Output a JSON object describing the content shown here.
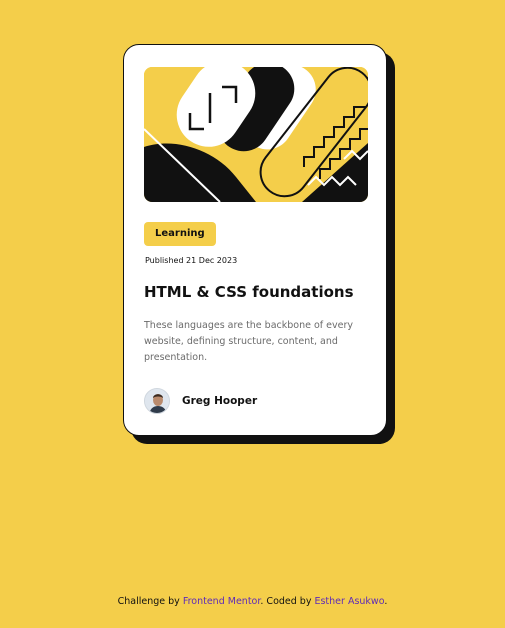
{
  "card": {
    "tag": "Learning",
    "published": "Published 21 Dec 2023",
    "title": "HTML & CSS foundations",
    "description": "These languages are the backbone of every website, defining structure, content, and presentation.",
    "author_name": "Greg Hooper"
  },
  "footer": {
    "prefix": "Challenge by ",
    "challenge_link": "Frontend Mentor",
    "middle": ". Coded by ",
    "coder_link": "Esther Asukwo",
    "suffix": "."
  },
  "colors": {
    "background": "#f4ce4a",
    "card": "#ffffff",
    "ink": "#111111",
    "link": "#5e2bb8"
  },
  "icons": {
    "hero": "illustration-article-image",
    "avatar": "author-avatar-image"
  }
}
